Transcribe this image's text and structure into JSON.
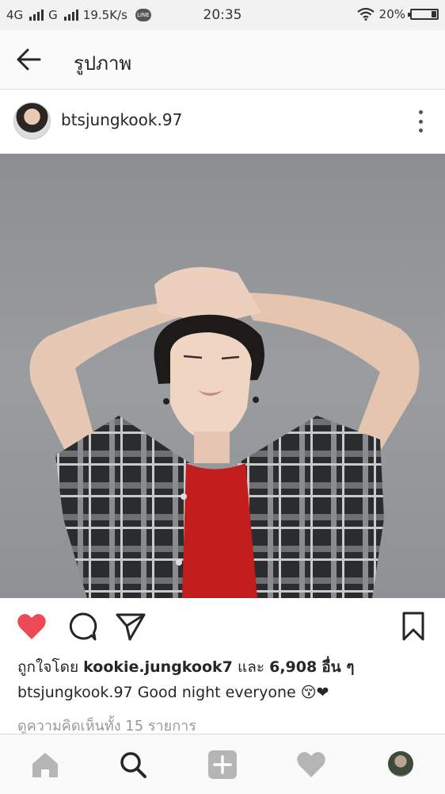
{
  "status_bar": {
    "network_1": "4G",
    "network_2": "G",
    "speed": "19.5K/s",
    "line_badge": "LINE",
    "time": "20:35",
    "battery": "20%",
    "battery_level": 0.2
  },
  "app_bar": {
    "title": "รูปภาพ",
    "back_icon": "arrow-left-icon"
  },
  "post": {
    "username": "btsjungkook.97",
    "more_icon": "more-vertical-icon",
    "photo_alt": "post-photo",
    "actions": {
      "like_icon": "heart-filled-icon",
      "comment_icon": "comment-icon",
      "share_icon": "send-icon",
      "save_icon": "bookmark-icon",
      "like_color": "#ed4956"
    },
    "likes": {
      "prefix": "ถูกใจโดย",
      "user": "kookie.jungkook7",
      "middle": "และ",
      "count": "6,908",
      "suffix": "อื่น ๆ"
    },
    "caption": {
      "username": "btsjungkook.97",
      "text": "Good night everyone 😚❤"
    },
    "comments_link": "ดูความคิดเห็นทั้ง 15 รายการ"
  },
  "bottom_nav": {
    "items": [
      "home-icon",
      "search-icon",
      "add-post-icon",
      "activity-heart-icon",
      "profile-avatar"
    ]
  }
}
